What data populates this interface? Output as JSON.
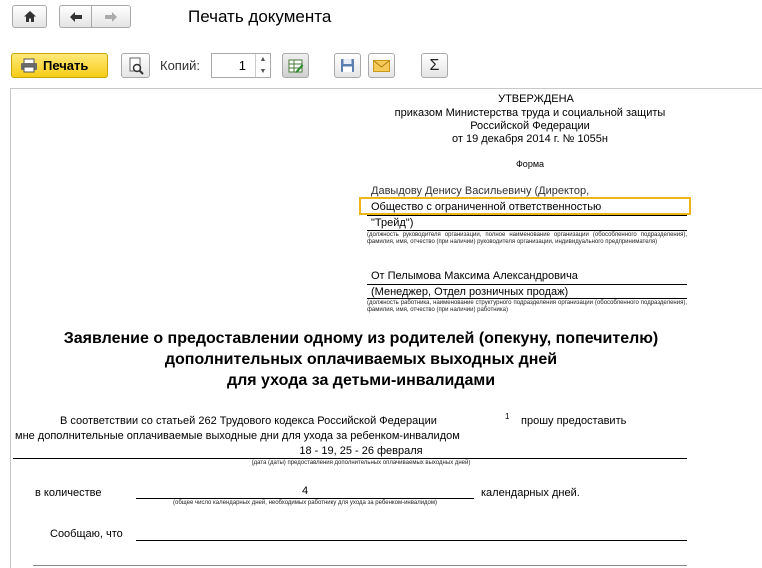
{
  "window": {
    "title": "Печать документа"
  },
  "toolbar": {
    "print_label": "Печать",
    "copies_label": "Копий:",
    "copies_value": "1",
    "spin_up": "▲",
    "spin_down": "▼",
    "sum_glyph": "Σ"
  },
  "doc": {
    "approved_lines": [
      "УТВЕРЖДЕНА",
      "приказом Министерства труда и социальной защиты",
      "Российской Федерации",
      "от 19 декабря 2014 г. № 1055н"
    ],
    "form_label": "Форма",
    "addressee_line1": "Давыдову Денису Васильевичу (Директор,",
    "addressee_line2": "Общество с ограниченной ответственностью",
    "addressee_line3": "\"Трейд\")",
    "addressee_hint": "(должность руководителя организации, полное наименование организации (обособленного подразделения), фамилия, имя, отчество (при наличии) руководителя организации, индивидуального предпринимателя)",
    "from_line1": "От Пелымова Максима Александровича",
    "from_line2": "(Менеджер, Отдел розничных продаж)",
    "from_hint": "(должность работника, наименование структурного подразделения организации (обособленного подразделения), фамилия, имя, отчество (при наличии) работника)",
    "heading_lines": [
      "Заявление о предоставлении одному из родителей (опекуну, попечителю)",
      "дополнительных оплачиваемых выходных дней",
      "для ухода за детьми-инвалидами"
    ],
    "body_line1": "В соответствии со статьей 262 Трудового кодекса Российской Федерации",
    "footnote_mark": "1",
    "body_line1_end": "прошу предоставить",
    "body_line2": "мне дополнительные оплачиваемые выходные дни для ухода за ребенком-инвалидом",
    "dates_value": "18 - 19, 25 - 26 февраля",
    "dates_hint": "(дата (даты) предоставления дополнительных оплачиваемых выходных дней)",
    "qty_prefix": "в количестве",
    "qty_value": "4",
    "qty_suffix": "календарных дней.",
    "qty_hint": "(общее число календарных дней, необходимых работнику для ухода за ребенком-инвалидом)",
    "inform_label": "Сообщаю, что"
  }
}
